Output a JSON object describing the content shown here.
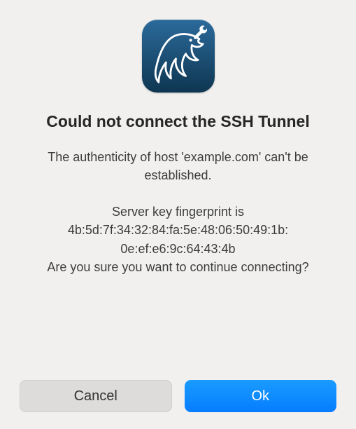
{
  "icon": {
    "name": "mysql-dolphin-icon",
    "wrench_name": "wrench-icon",
    "bg_top": "#2b6a9b",
    "bg_bottom": "#0f3651"
  },
  "title": "Could not connect the\nSSH Tunnel",
  "message": "The authenticity of host 'example.com' can't be established.\n\nServer key fingerprint is\n4b:5d:7f:34:32:84:fa:5e:48:06:50:49:1b:\n0e:ef:e6:9c:64:43:4b\nAre you sure you want to continue connecting?",
  "buttons": {
    "cancel": "Cancel",
    "ok": "Ok"
  }
}
